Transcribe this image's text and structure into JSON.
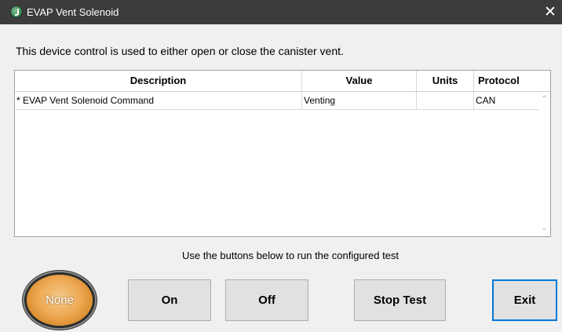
{
  "window": {
    "title": "EVAP Vent Solenoid",
    "close_glyph": "✕",
    "icon": "app-logo-icon"
  },
  "description": "This device control is used to either open or close the canister vent.",
  "table": {
    "columns": [
      "Description",
      "Value",
      "Units",
      "Protocol"
    ],
    "rows": [
      {
        "description": "* EVAP Vent Solenoid Command",
        "value": "Venting",
        "units": "",
        "protocol": "CAN"
      }
    ]
  },
  "instruction": "Use the buttons below to run the configured test",
  "status": {
    "label": "None",
    "color": "#eeaa55"
  },
  "buttons": {
    "on": "On",
    "off": "Off",
    "stop": "Stop Test",
    "exit": "Exit"
  },
  "colors": {
    "titlebar": "#3c3c3c",
    "focus_border": "#0078d7"
  }
}
